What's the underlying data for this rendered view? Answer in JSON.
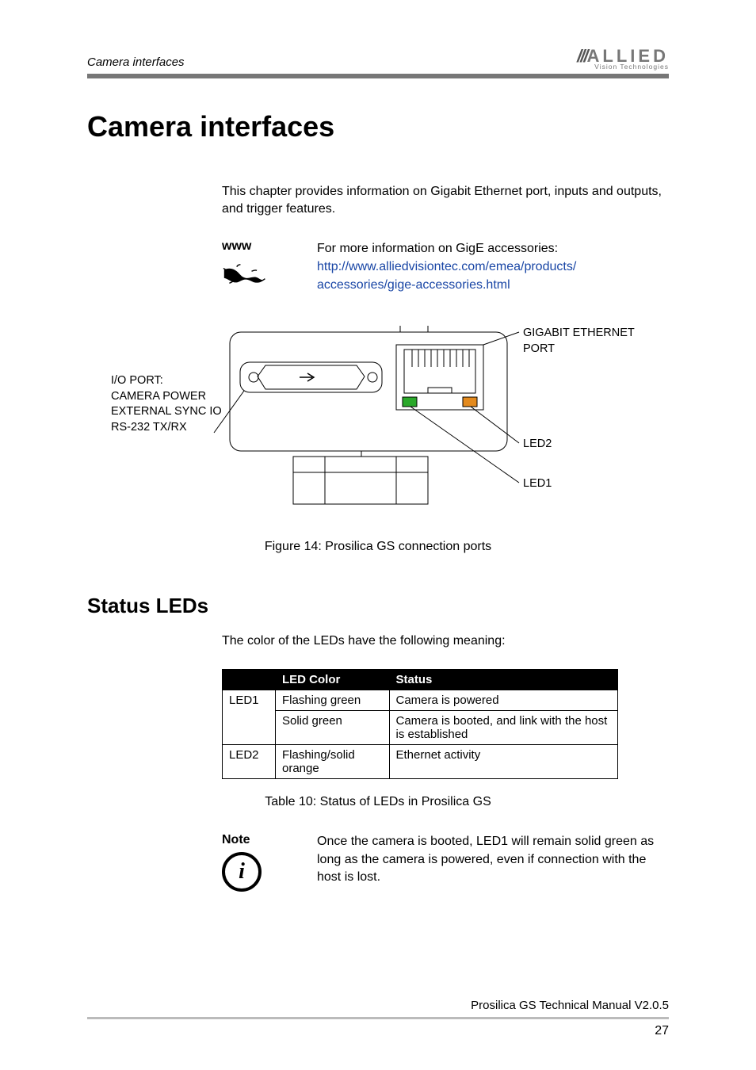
{
  "header": {
    "running_head": "Camera interfaces",
    "logo_main": "ALLIED",
    "logo_sub": "Vision Technologies"
  },
  "title": "Camera interfaces",
  "intro": "This chapter provides information on Gigabit Ethernet port, inputs and outputs, and trigger features.",
  "www": {
    "label": "www",
    "lead": "For more information on GigE accessories:",
    "url_line1": "http://www.alliedvisiontec.com/emea/products/",
    "url_line2": "accessories/gige-accessories.html"
  },
  "figure": {
    "label_gige": "GIGABIT ETHERNET PORT",
    "label_io_1": "I/O PORT:",
    "label_io_2": "CAMERA POWER",
    "label_io_3": "EXTERNAL SYNC IO",
    "label_io_4": "RS-232 TX/RX",
    "label_led2": "LED2",
    "label_led1": "LED1",
    "caption": "Figure 14: Prosilica GS connection ports"
  },
  "section2": {
    "heading": "Status LEDs",
    "lead": "The color of the LEDs have the following meaning:",
    "table": {
      "head_color": "LED Color",
      "head_status": "Status",
      "rows": [
        {
          "rowlabel": "LED1",
          "color": "Flashing green",
          "status": "Camera is powered"
        },
        {
          "rowlabel": "",
          "color": "Solid green",
          "status": "Camera is booted, and link with the host is established"
        },
        {
          "rowlabel": "LED2",
          "color": "Flashing/solid orange",
          "status": "Ethernet activity"
        }
      ],
      "caption": "Table 10: Status of LEDs in Prosilica GS"
    },
    "note": {
      "label": "Note",
      "text": "Once the camera is booted, LED1 will remain solid green as long as the camera is powered, even if connection with the host is lost."
    }
  },
  "footer": {
    "doc": "Prosilica GS Technical Manual  V2.0.5",
    "page": "27"
  }
}
